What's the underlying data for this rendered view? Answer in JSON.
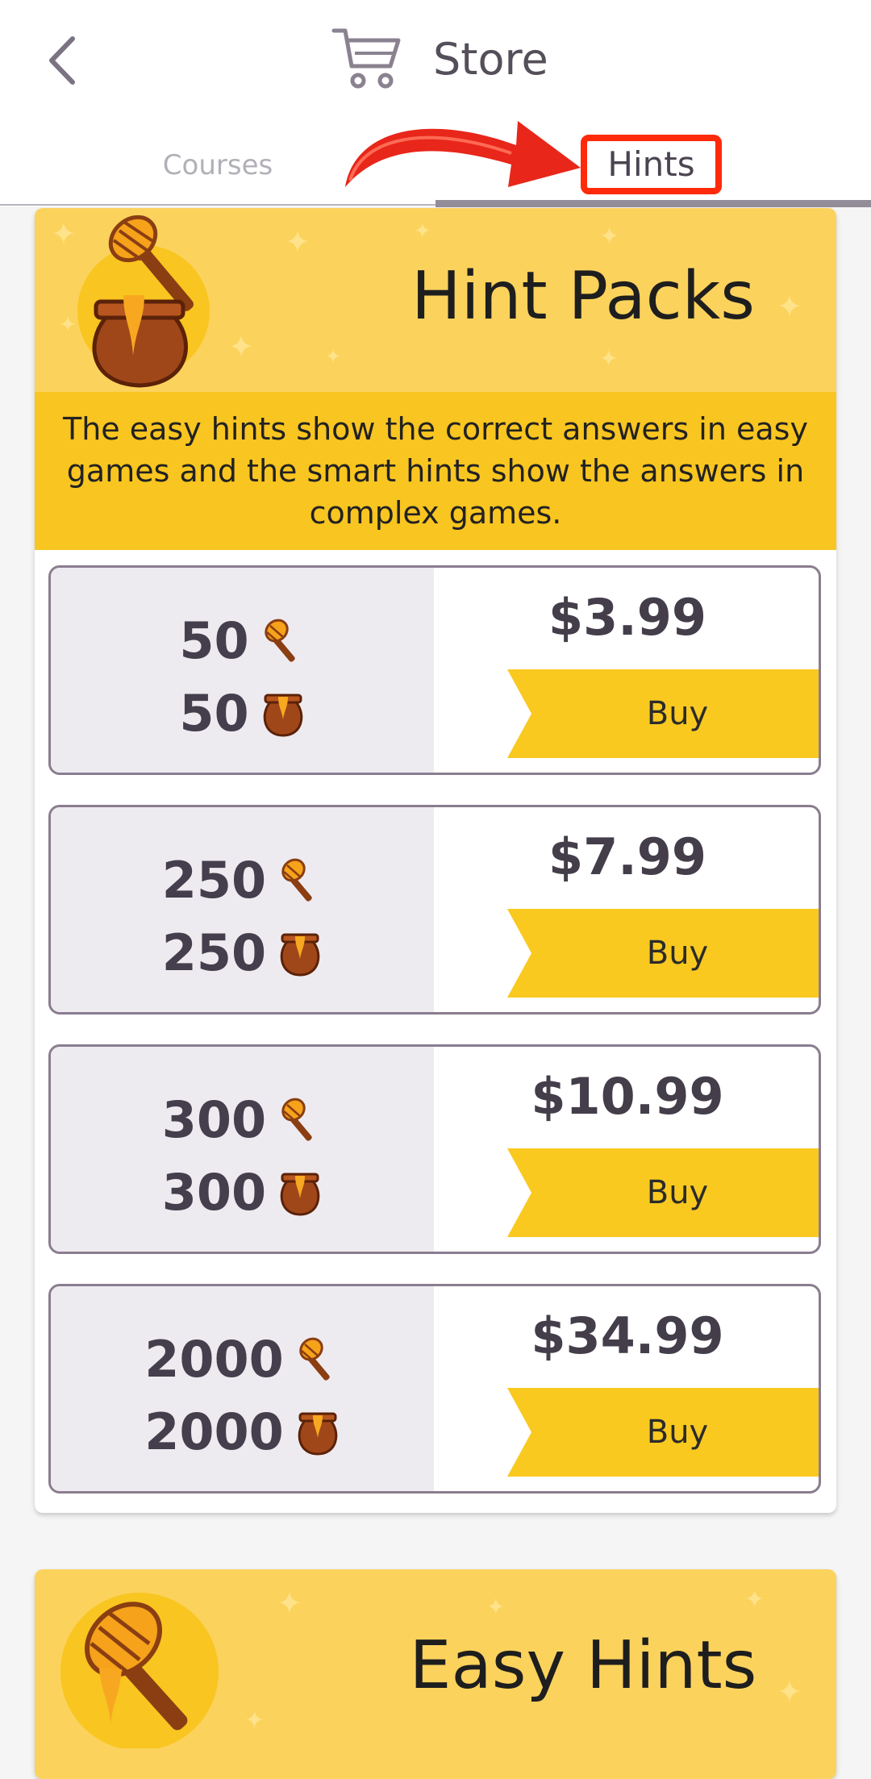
{
  "header": {
    "title": "Store",
    "tabs": [
      {
        "label": "Courses",
        "active": false
      },
      {
        "label": "Hints",
        "active": true
      }
    ]
  },
  "hint_packs": {
    "title": "Hint Packs",
    "description": "The easy hints show the correct answers in easy games and the smart hints show the answers in complex games.",
    "packs": [
      {
        "easy": "50",
        "smart": "50",
        "price": "$3.99",
        "buy": "Buy"
      },
      {
        "easy": "250",
        "smart": "250",
        "price": "$7.99",
        "buy": "Buy"
      },
      {
        "easy": "300",
        "smart": "300",
        "price": "$10.99",
        "buy": "Buy"
      },
      {
        "easy": "2000",
        "smart": "2000",
        "price": "$34.99",
        "buy": "Buy"
      }
    ]
  },
  "easy_hints": {
    "title": "Easy Hints"
  },
  "colors": {
    "banner": "#fbd25c",
    "desc_band": "#f9c520",
    "buy_button": "#f9c920",
    "highlight": "#ff2a0a",
    "active_underline": "#938c99"
  },
  "icons": [
    "back-chevron-icon",
    "cart-icon",
    "honey-dipper-icon",
    "honey-pot-icon",
    "red-arrow-icon"
  ]
}
